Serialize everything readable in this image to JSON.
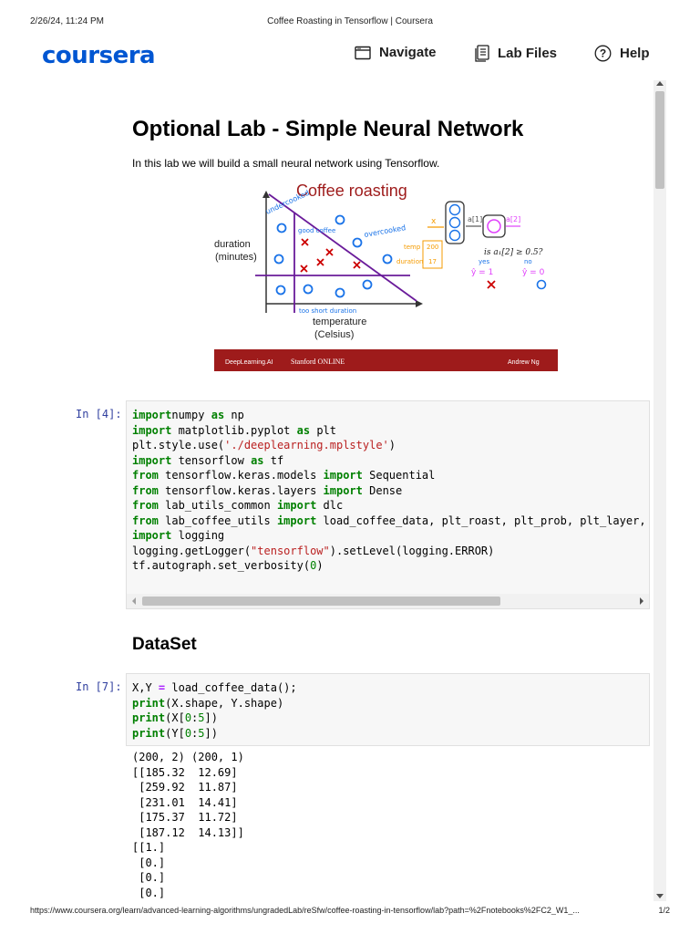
{
  "print_header": {
    "date": "2/26/24, 11:24 PM",
    "title": "Coffee Roasting in Tensorflow | Coursera"
  },
  "print_footer": {
    "url": "https://www.coursera.org/learn/advanced-learning-algorithms/ungradedLab/reSfw/coffee-roasting-in-tensorflow/lab?path=%2Fnotebooks%2FC2_W1_...",
    "page": "1/2"
  },
  "header": {
    "logo": "coursera",
    "navigate_label": "Navigate",
    "labfiles_label": "Lab Files",
    "help_label": "Help"
  },
  "notebook": {
    "title": "Optional Lab - Simple Neural Network",
    "intro": "In this lab we will build a small neural network using Tensorflow.",
    "figure": {
      "title": "Coffee roasting",
      "ylabel_line1": "duration",
      "ylabel_line2": "(minutes)",
      "xlabel_line1": "temperature",
      "xlabel_line2": "(Celsius)",
      "ann_undercooked": "undercooked",
      "ann_good_coffee": "good coffee",
      "ann_overcooked": "overcooked",
      "ann_short_duration": "too short duration",
      "ann_temp": "temp",
      "ann_temp_val": "200",
      "ann_duration": "duration",
      "ann_duration_val": "17",
      "ann_x_vec": "x",
      "ann_a1": "a[1]",
      "ann_a2": "a[2]",
      "ann_is": "is a₁[2] ≥ 0.5?",
      "ann_yes": "yes",
      "ann_no": "no",
      "ann_yhat1": "ŷ = 1",
      "ann_yhat0": "ŷ = 0",
      "footer_left": "DeepLearning.AI",
      "footer_mid": "Stanford ONLINE",
      "footer_right": "Andrew Ng",
      "colors": {
        "footer_bg": "#9e1b1b",
        "cross": "#cc0000",
        "circle": "#1a73e8",
        "purple": "#6a1b9a",
        "orange": "#f59b00",
        "magenta": "#e040fb"
      }
    },
    "cell1": {
      "prompt": "In [4]:",
      "lines": [
        [
          [
            "kw",
            "import"
          ],
          [
            "",
            "numpy "
          ],
          [
            "kw",
            "as"
          ],
          [
            "",
            " np"
          ]
        ],
        [
          [
            "kw",
            "import"
          ],
          [
            "",
            " matplotlib.pyplot "
          ],
          [
            "kw",
            "as"
          ],
          [
            "",
            " plt"
          ]
        ],
        [
          [
            "",
            "plt.style.use("
          ],
          [
            "str",
            "'./deeplearning.mplstyle'"
          ],
          [
            "",
            ")"
          ]
        ],
        [
          [
            "kw",
            "import"
          ],
          [
            "",
            " tensorflow "
          ],
          [
            "kw",
            "as"
          ],
          [
            "",
            " tf"
          ]
        ],
        [
          [
            "kw",
            "from"
          ],
          [
            "",
            " tensorflow.keras.models "
          ],
          [
            "kw",
            "import"
          ],
          [
            "",
            " Sequential"
          ]
        ],
        [
          [
            "kw",
            "from"
          ],
          [
            "",
            " tensorflow.keras.layers "
          ],
          [
            "kw",
            "import"
          ],
          [
            "",
            " Dense"
          ]
        ],
        [
          [
            "kw",
            "from"
          ],
          [
            "",
            " lab_utils_common "
          ],
          [
            "kw",
            "import"
          ],
          [
            "",
            " dlc"
          ]
        ],
        [
          [
            "kw",
            "from"
          ],
          [
            "",
            " lab_coffee_utils "
          ],
          [
            "kw",
            "import"
          ],
          [
            "",
            " load_coffee_data, plt_roast, plt_prob, plt_layer,"
          ]
        ],
        [
          [
            "kw",
            "import"
          ],
          [
            "",
            " logging"
          ]
        ],
        [
          [
            "",
            "logging.getLogger("
          ],
          [
            "str",
            "\"tensorflow\""
          ],
          [
            "",
            ").setLevel(logging.ERROR)"
          ]
        ],
        [
          [
            "",
            "tf.autograph.set_verbosity("
          ],
          [
            "num",
            "0"
          ],
          [
            "",
            ")"
          ]
        ]
      ]
    },
    "section_title": "DataSet",
    "cell2": {
      "prompt": "In [7]:",
      "lines": [
        [
          [
            "",
            "X,Y "
          ],
          [
            "op",
            "="
          ],
          [
            "",
            " load_coffee_data();"
          ]
        ],
        [
          [
            "kw",
            "print"
          ],
          [
            "",
            "(X.shape, Y.shape)"
          ]
        ],
        [
          [
            "kw",
            "print"
          ],
          [
            "",
            "(X["
          ],
          [
            "num",
            "0"
          ],
          [
            "",
            ":"
          ],
          [
            "num",
            "5"
          ],
          [
            "",
            "])"
          ]
        ],
        [
          [
            "kw",
            "print"
          ],
          [
            "",
            "(Y["
          ],
          [
            "num",
            "0"
          ],
          [
            "",
            ":"
          ],
          [
            "num",
            "5"
          ],
          [
            "",
            "])"
          ]
        ]
      ]
    },
    "output2": "(200, 2) (200, 1)\n[[185.32  12.69]\n [259.92  11.87]\n [231.01  14.41]\n [175.37  11.72]\n [187.12  14.13]]\n[[1.]\n [0.]\n [0.]\n [0.]"
  }
}
